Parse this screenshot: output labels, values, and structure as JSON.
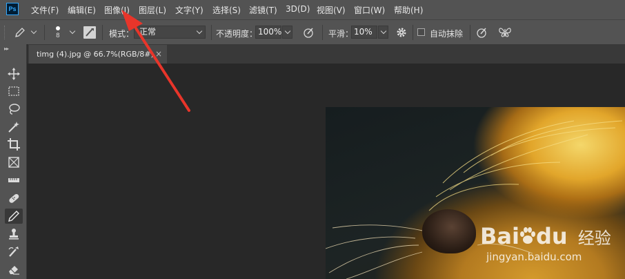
{
  "app": {
    "logo_text": "Ps"
  },
  "menu": [
    "文件(F)",
    "编辑(E)",
    "图像(I)",
    "图层(L)",
    "文字(Y)",
    "选择(S)",
    "滤镜(T)",
    "3D(D)",
    "视图(V)",
    "窗口(W)",
    "帮助(H)"
  ],
  "options": {
    "brush_size": "8",
    "mode_label": "模式：",
    "mode_value": "正常",
    "opacity_label": "不透明度：",
    "opacity_value": "100%",
    "smoothing_label": "平滑：",
    "smoothing_value": "10%",
    "auto_erase_label": "自动抹除",
    "auto_erase_checked": false
  },
  "document": {
    "tab_title": "timg (4).jpg @ 66.7%(RGB/8#)",
    "close_glyph": "×"
  },
  "watermark": {
    "brand": "Bai",
    "brand2": "du",
    "suffix": "经验",
    "url": "jingyan.baidu.com"
  },
  "annotation": {
    "arrow_color": "#e8352a"
  }
}
